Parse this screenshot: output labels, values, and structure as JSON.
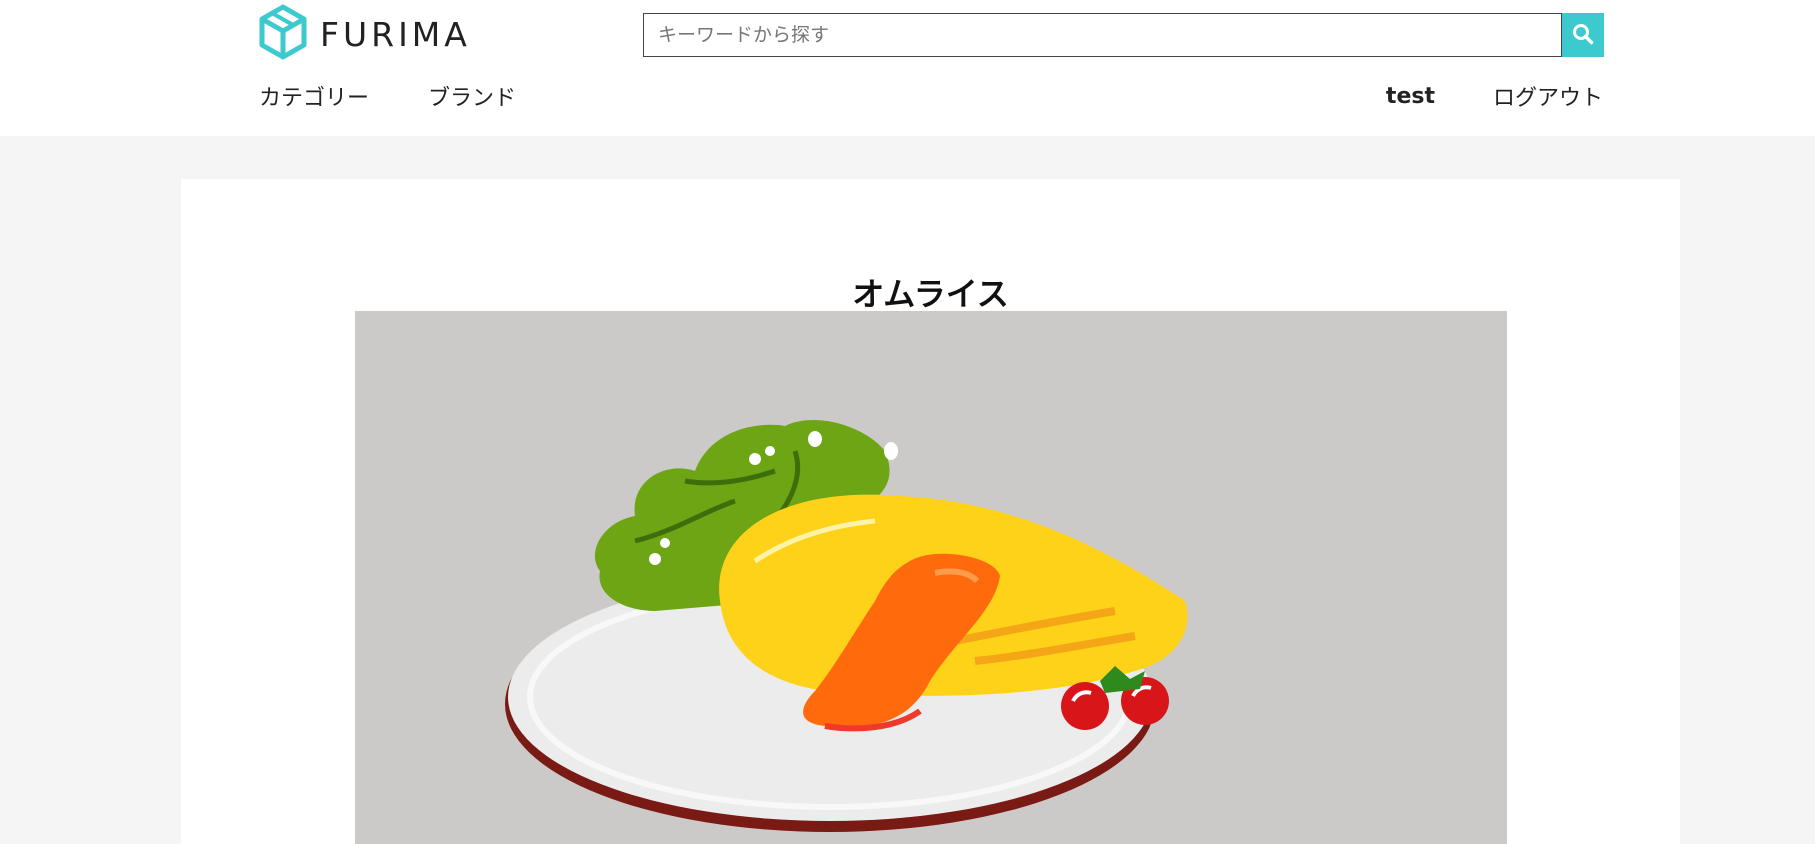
{
  "header": {
    "logo_text": "FURIMA",
    "search": {
      "placeholder": "キーワードから探す"
    },
    "nav_left": [
      "カテゴリー",
      "ブランド"
    ],
    "user_name": "test",
    "logout_label": "ログアウト"
  },
  "item": {
    "title": "オムライス",
    "image": "omurice-illustration"
  },
  "colors": {
    "accent": "#3ccace",
    "page_bg": "#f5f5f5",
    "image_bg": "#cbcac9"
  },
  "icons": {
    "logo": "cube-logo-icon",
    "search": "search-icon"
  }
}
